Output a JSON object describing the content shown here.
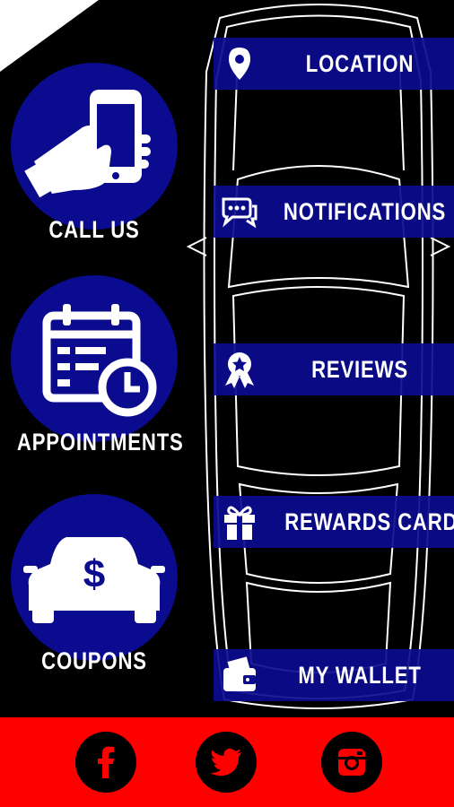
{
  "colors": {
    "background": "#000000",
    "accent_blue": "#0b0b8f",
    "footer_red": "#ff0000",
    "text": "#ffffff"
  },
  "circle_buttons": [
    {
      "label": "CALL US",
      "icon": "phone-hand-icon"
    },
    {
      "label": "APPOINTMENTS",
      "icon": "calendar-clock-icon"
    },
    {
      "label": "COUPONS",
      "icon": "car-dollar-icon"
    }
  ],
  "menu": [
    {
      "label": "LOCATION",
      "icon": "map-pin-icon"
    },
    {
      "label": "NOTIFICATIONS",
      "icon": "chat-bubbles-icon"
    },
    {
      "label": "REVIEWS",
      "icon": "award-ribbon-icon"
    },
    {
      "label": "REWARDS CARD",
      "icon": "gift-icon"
    },
    {
      "label": "MY WALLET",
      "icon": "wallet-icon"
    }
  ],
  "social": [
    {
      "icon": "facebook-icon"
    },
    {
      "icon": "twitter-icon"
    },
    {
      "icon": "instagram-icon"
    }
  ]
}
